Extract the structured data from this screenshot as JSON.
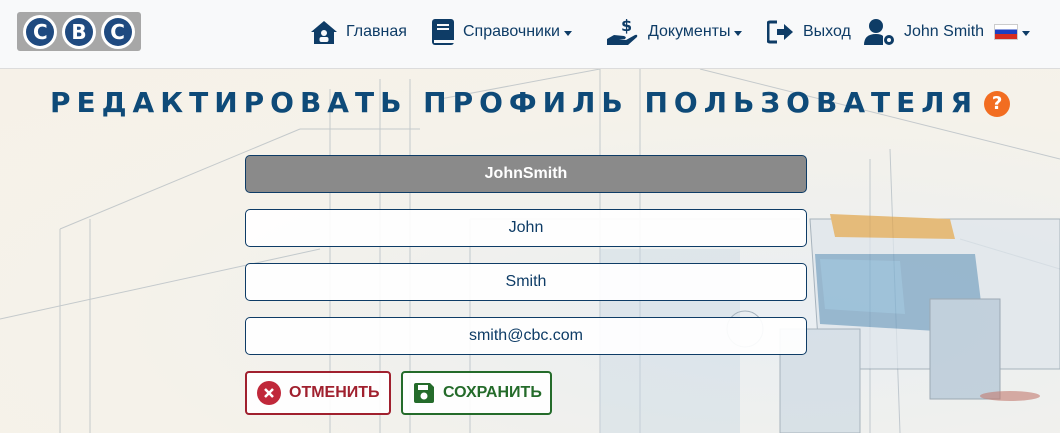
{
  "nav": {
    "logo_letters": [
      "C",
      "B",
      "C"
    ],
    "home": "Главная",
    "directories": "Справочники",
    "documents": "Документы",
    "logout": "Выход",
    "user": "John Smith",
    "language_flag": "ru"
  },
  "page": {
    "title": "РЕДАКТИРОВАТЬ ПРОФИЛЬ ПОЛЬЗОВАТЕЛЯ",
    "help_symbol": "?"
  },
  "form": {
    "username": "JohnSmith",
    "first_name": "John",
    "last_name": "Smith",
    "email": "smith@cbc.com"
  },
  "buttons": {
    "cancel": "ОТМЕНИТЬ",
    "save": "СОХРАНИТЬ"
  },
  "colors": {
    "primary": "#0e3c66",
    "help_orange": "#f26d21",
    "cancel_red": "#a0202e",
    "save_green": "#246b2a"
  }
}
